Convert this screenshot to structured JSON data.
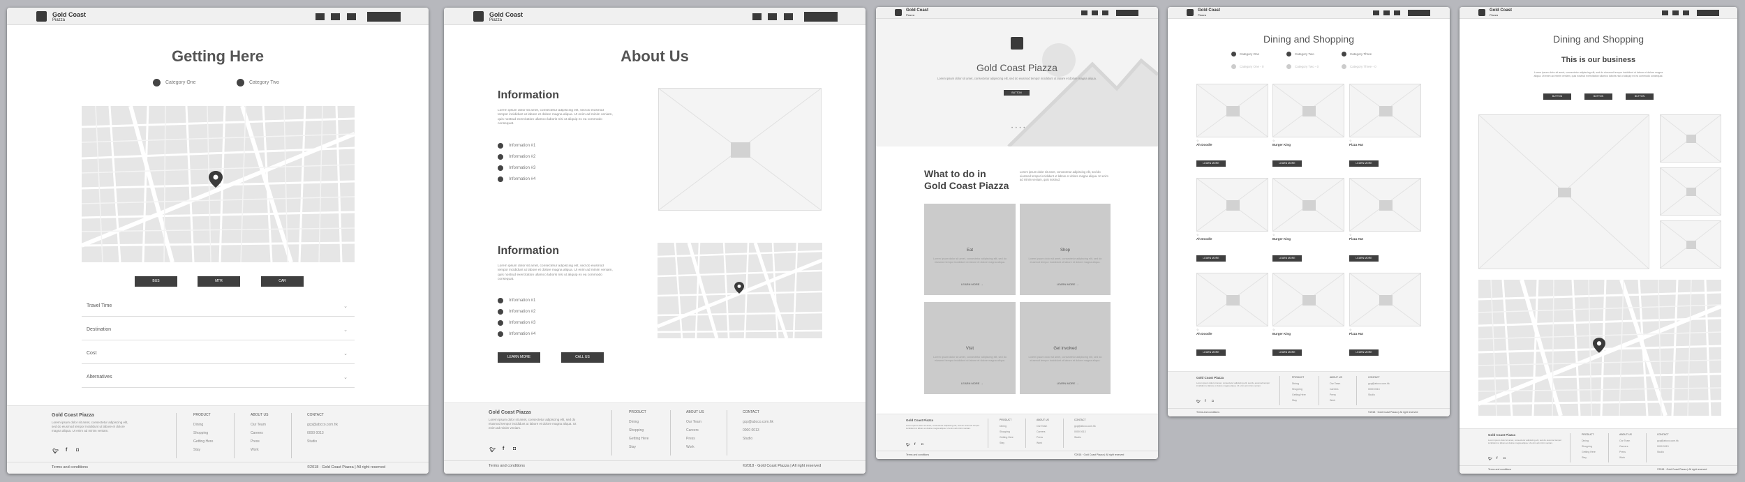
{
  "brand": {
    "name": "Gold Coast",
    "sub": "Piazza",
    "color_dark": "#3a3a3a",
    "color_bg": "#b7b8bd"
  },
  "footer": {
    "title": "Gold Coast Piazza",
    "blurb": "Lorem ipsum dolor sit amet, consectetur adipiscing elit, sed do eiusmod tempor incididunt ut labore et dolore magna aliqua. Ut enim ad minim veniam.",
    "col1": {
      "head": "PRODUCT",
      "links": [
        "Dining",
        "Shopping",
        "Getting Here",
        "Stay"
      ]
    },
    "col2": {
      "head": "ABOUT US",
      "links": [
        "Our Team",
        "Careers",
        "Press",
        "Work"
      ]
    },
    "col3": {
      "head": "CONTACT",
      "links": [
        "gcp@abcco.com.hk",
        "0000 0013",
        "Studio"
      ]
    },
    "terms": "Terms and conditions",
    "copyright": "©2018 · Gold Coast Piazza  |  All right reserved",
    "social": [
      "twitter",
      "facebook",
      "instagram"
    ]
  },
  "frame1": {
    "title": "Getting Here",
    "cat1": "Category One",
    "cat2": "Category Two",
    "buttons": [
      "BUS",
      "MTR",
      "CAR"
    ],
    "accordion": [
      "Travel Time",
      "Destination",
      "Cost",
      "Alternatives"
    ]
  },
  "frame2": {
    "title": "About Us",
    "info_heading": "Information",
    "lorem": "Lorem ipsum dolor sit amet, consectetur adipiscing elit, sed do eiusmod tempor incididunt ut labore et dolore magna aliqua. Ut enim ad minim veniam, quis nostrud exercitation ullamco laboris nisi ut aliquip ex ea commodo consequat.",
    "items": [
      "Information #1",
      "Information #2",
      "Information #3",
      "Information #4"
    ],
    "btn_learn": "LEARN MORE",
    "btn_call": "CALL US"
  },
  "frame3": {
    "hero_title": "Gold Coast Piazza",
    "hero_text": "Lorem ipsum dolor sit amet, consectetur adipiscing elit, sed do eiusmod tempor incididunt ut labore et dolore magna aliqua.",
    "hero_btn": "BUTTON",
    "section_title_1": "What to do in",
    "section_title_2": "Gold Coast Piazza",
    "section_text": "Lorem ipsum dolor sit amet, consectetur adipiscing elit, sed do eiusmod tempor incididunt ut labore et dolore magna aliqua. Ut enim ad minim veniam, quis nostrud.",
    "cards": [
      "Eat",
      "Shop",
      "Visit",
      "Get involved"
    ],
    "card_text": "Lorem ipsum dolor sit amet, consectetur adipiscing elit, sed do eiusmod tempor incididunt ut labore et dolore magna aliqua.",
    "card_link": "LEARN MORE"
  },
  "frame4": {
    "title": "Dining and Shopping",
    "filters": [
      "Category One",
      "Category Two",
      "Category Three"
    ],
    "filters_off": [
      "Category One - 0",
      "Category Two - 0",
      "Category Three - 0"
    ],
    "products": [
      "Ah Doodle",
      "Burger King",
      "Pizza Hut"
    ],
    "btn": "LEARN MORE"
  },
  "frame5": {
    "title": "Dining and Shopping",
    "subtitle": "This is our business",
    "text": "Lorem ipsum dolor sit amet, consectetur adipiscing elit, sed do eiusmod tempor incididunt ut labore et dolore magna aliqua. Ut enim ad minim veniam, quis nostrud exercitation ullamco laboris nisi ut aliquip ex ea commodo consequat.",
    "buttons": [
      "BUTTON",
      "BUTTON",
      "BUTTON"
    ]
  }
}
